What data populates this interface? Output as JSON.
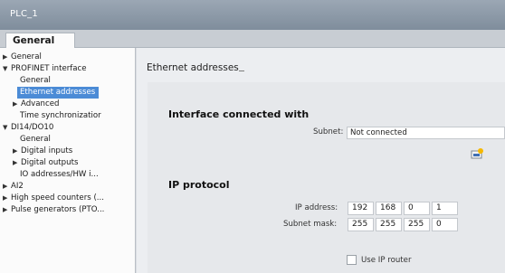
{
  "window": {
    "title": "PLC_1"
  },
  "tabs": [
    {
      "label": "General"
    }
  ],
  "sidebar": {
    "items": [
      {
        "label": "General",
        "arrow": "right"
      },
      {
        "label": "PROFINET interface",
        "arrow": "down"
      },
      {
        "label": "General",
        "arrow": ""
      },
      {
        "label": "Ethernet addresses",
        "arrow": "",
        "selected": true
      },
      {
        "label": "Advanced",
        "arrow": "right"
      },
      {
        "label": "Time synchronizatior",
        "arrow": ""
      },
      {
        "label": "DI14/DO10",
        "arrow": "down"
      },
      {
        "label": "General",
        "arrow": ""
      },
      {
        "label": "Digital inputs",
        "arrow": "right"
      },
      {
        "label": "Digital outputs",
        "arrow": "right"
      },
      {
        "label": "IO addresses/HW i...",
        "arrow": ""
      },
      {
        "label": "AI2",
        "arrow": "right"
      },
      {
        "label": "High speed counters (...",
        "arrow": "right"
      },
      {
        "label": "Pulse generators (PTO...",
        "arrow": "right"
      }
    ]
  },
  "content": {
    "section_title": "Ethernet addresses",
    "interface": {
      "heading": "Interface connected with",
      "subnet_label": "Subnet:",
      "subnet_value": "Not connected"
    },
    "ip_protocol": {
      "heading": "IP protocol",
      "ip_label": "IP address:",
      "ip_address": [
        "192",
        "168",
        "0",
        "1"
      ],
      "mask_label": "Subnet mask:",
      "subnet_mask": [
        "255",
        "255",
        "255",
        "0"
      ],
      "router_label": "Use IP router",
      "use_router": false
    }
  }
}
